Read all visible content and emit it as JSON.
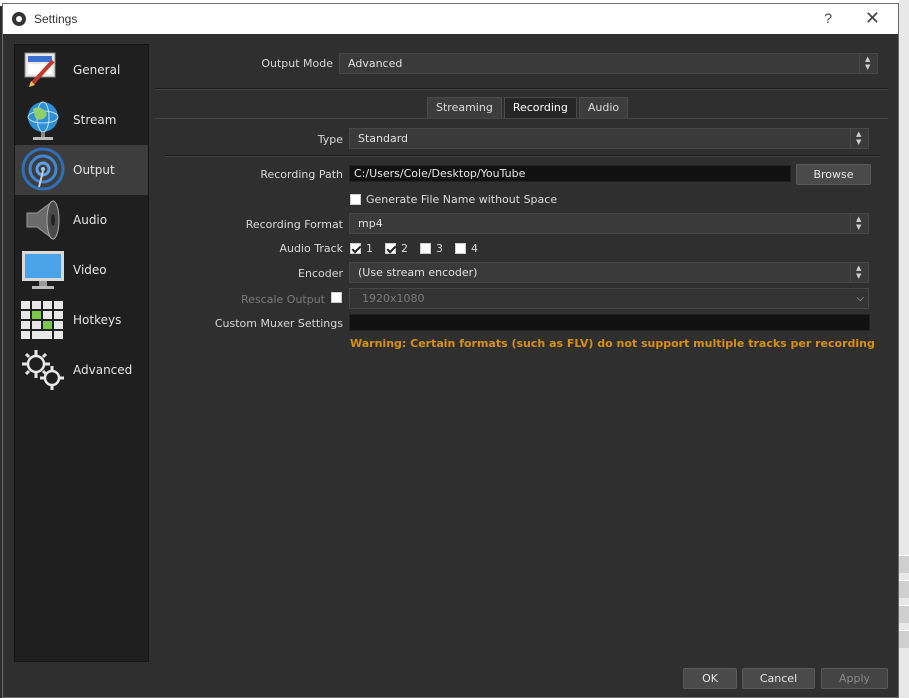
{
  "window": {
    "title": "Settings",
    "help_glyph": "?",
    "close_glyph": "✕"
  },
  "sidebar": {
    "items": [
      {
        "label": "General",
        "icon": "general-icon"
      },
      {
        "label": "Stream",
        "icon": "stream-globe-icon"
      },
      {
        "label": "Output",
        "icon": "output-broadcast-icon",
        "active": true
      },
      {
        "label": "Audio",
        "icon": "speaker-icon"
      },
      {
        "label": "Video",
        "icon": "monitor-icon"
      },
      {
        "label": "Hotkeys",
        "icon": "keyboard-icon"
      },
      {
        "label": "Advanced",
        "icon": "gears-icon"
      }
    ]
  },
  "output": {
    "mode_label": "Output Mode",
    "mode_value": "Advanced",
    "tabs": [
      {
        "label": "Streaming"
      },
      {
        "label": "Recording",
        "active": true
      },
      {
        "label": "Audio"
      }
    ],
    "type_label": "Type",
    "type_value": "Standard",
    "recording_path_label": "Recording Path",
    "recording_path_value": "C:/Users/Cole/Desktop/YouTube",
    "browse_label": "Browse",
    "generate_filename_label": "Generate File Name without Space",
    "generate_filename_checked": false,
    "recording_format_label": "Recording Format",
    "recording_format_value": "mp4",
    "audio_track_label": "Audio Track",
    "audio_tracks": [
      {
        "label": "1",
        "checked": true
      },
      {
        "label": "2",
        "checked": true
      },
      {
        "label": "3",
        "checked": false
      },
      {
        "label": "4",
        "checked": false
      }
    ],
    "encoder_label": "Encoder",
    "encoder_value": "(Use stream encoder)",
    "rescale_label": "Rescale Output",
    "rescale_checked": false,
    "rescale_value": "1920x1080",
    "custom_muxer_label": "Custom Muxer Settings",
    "custom_muxer_value": "",
    "warning": "Warning: Certain formats (such as FLV) do not support multiple tracks per recording"
  },
  "footer": {
    "ok_label": "OK",
    "cancel_label": "Cancel",
    "apply_label": "Apply"
  },
  "colors": {
    "warning": "#d6900e",
    "active_sidebar": "#3d3d3d",
    "background": "#2f2f2f"
  }
}
